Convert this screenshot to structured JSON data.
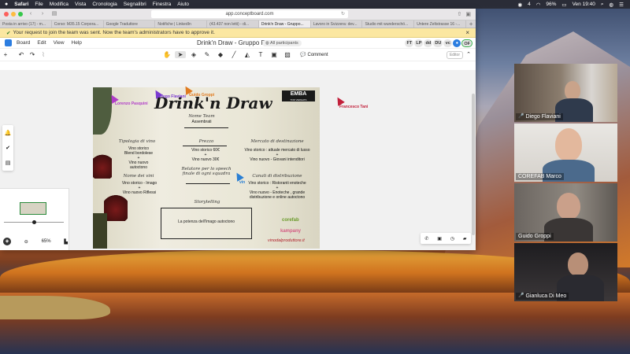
{
  "menubar": {
    "apple": "",
    "app": "Safari",
    "items": [
      "File",
      "Modifica",
      "Vista",
      "Cronologia",
      "Segnalibri",
      "Finestra",
      "Aiuto"
    ],
    "battery": "96%",
    "clock": "Ven 19:40",
    "notifications": "4"
  },
  "browser": {
    "url": "app.conceptboard.com",
    "tabs": [
      "Posta in arrivo (17) - m...",
      "Corso: M35.15 Corpora...",
      "Google Traduttore",
      "Notifiche | LinkedIn",
      "(43.437 non letti) - di...",
      "Drink'n Draw - Gruppo...",
      "Lavoro in Svizzera: dev...",
      "Studio mit wunderschö...",
      "Untere Zeltstrasse 16 -..."
    ],
    "active_tab_index": 5
  },
  "banner": {
    "text": "Your request to join the team was sent. Now the team's administrators have to approve it."
  },
  "app": {
    "menu": [
      "Board",
      "Edit",
      "View",
      "Help"
    ],
    "board_title": "Drink'n Draw - Gruppo F",
    "participants_label": "All participants",
    "avatars": [
      "FT",
      "LP",
      "dd",
      "DU",
      "vc"
    ],
    "self_avatar": "OF",
    "comment_label": "Comment",
    "editor_label": "Editor"
  },
  "minimap": {
    "zoom": "65%"
  },
  "board": {
    "title": "Drink'n Draw",
    "logo_main": "EMBA",
    "logo_sub": "TOR VERGATA",
    "nome_team_label": "Nome Team",
    "nome_team_value": "Assembrati",
    "tipologia_label": "Tipologia di vino",
    "tipologia_values": [
      "Vino  storico",
      "Blend bordolese",
      "+",
      "Vino nuovo",
      "autoctono"
    ],
    "prezzo_label": "Prezzo",
    "prezzo_values": [
      "Vino  storico 60€",
      "+",
      "Vino nuovo 30€"
    ],
    "mercato_label": "Mercato di destinazione",
    "mercato_values": [
      "Vino  storico : attuale mercato di lusso",
      "+",
      "Vino nuovo - Giovani intenditori"
    ],
    "nome_vini_label": "Nome dei vini",
    "nome_vini_values": [
      "Vino  storico - Imago",
      "+",
      "Vino nuovo Riflessi"
    ],
    "relatore_label": "Relatore per lo speech finale di ogni squadra",
    "canali_label": "Canali di distribuzione",
    "canali_values": [
      "Vino  storico : Ristoranti enoteche",
      "+",
      "Vino nuovo - Enoteche , grande",
      "distribuzione e online  autoctono"
    ],
    "storytelling_label": "Storytelling",
    "storytelling_value": "La potenza dell'Imago autoctono",
    "sponsor_corefab": "corefab",
    "sponsor_kampany": "kampany",
    "sponsor_vino": "vinodalproduttore.it"
  },
  "cursors": [
    {
      "name": "Lorenzo Pasquini",
      "color": "#b03cc8"
    },
    {
      "name": "Diego Flaviani",
      "color": "#7a3ad0"
    },
    {
      "name": "Guido Groppi",
      "color": "#e07a1f"
    },
    {
      "name": "Francesco Tani",
      "color": "#c21f3a"
    },
    {
      "name": "vin",
      "color": "#2a7fd4"
    }
  ],
  "videos": [
    {
      "name": "Diego Flaviani"
    },
    {
      "name": "COREFAB Marco"
    },
    {
      "name": "Guido Groppi"
    },
    {
      "name": "Gianluca Di Meo"
    }
  ],
  "icons": {
    "back": "chevron-left-icon",
    "forward": "chevron-right-icon",
    "share": "share-icon",
    "close": "close-icon"
  }
}
